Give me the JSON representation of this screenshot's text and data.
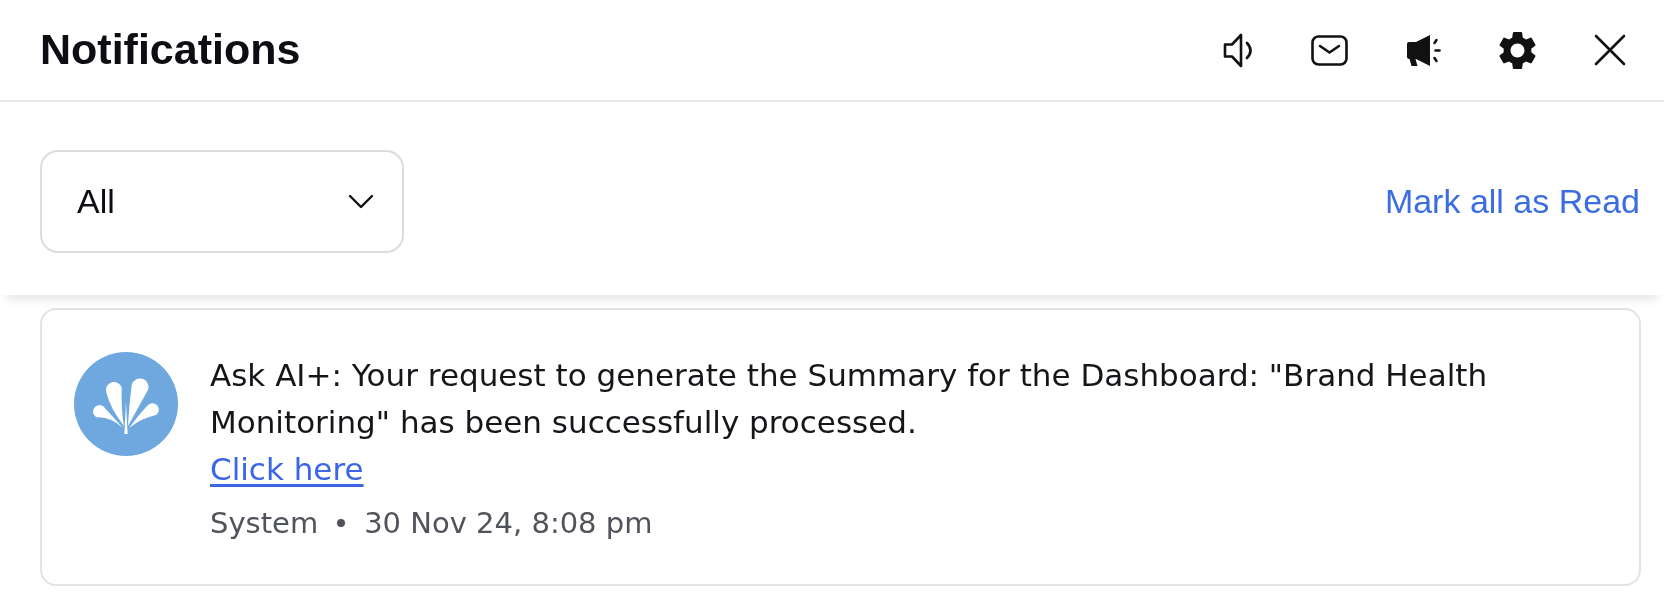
{
  "header": {
    "title": "Notifications"
  },
  "filter_bar": {
    "dropdown_value": "All",
    "mark_all_link": "Mark all as Read"
  },
  "notifications": [
    {
      "message": "Ask AI+: Your request to generate the Summary for the Dashboard: \"Brand Health Monitoring\" has been successfully processed.",
      "link": "Click here",
      "source": "System",
      "time": "30 Nov 24, 8:08 pm"
    }
  ]
}
